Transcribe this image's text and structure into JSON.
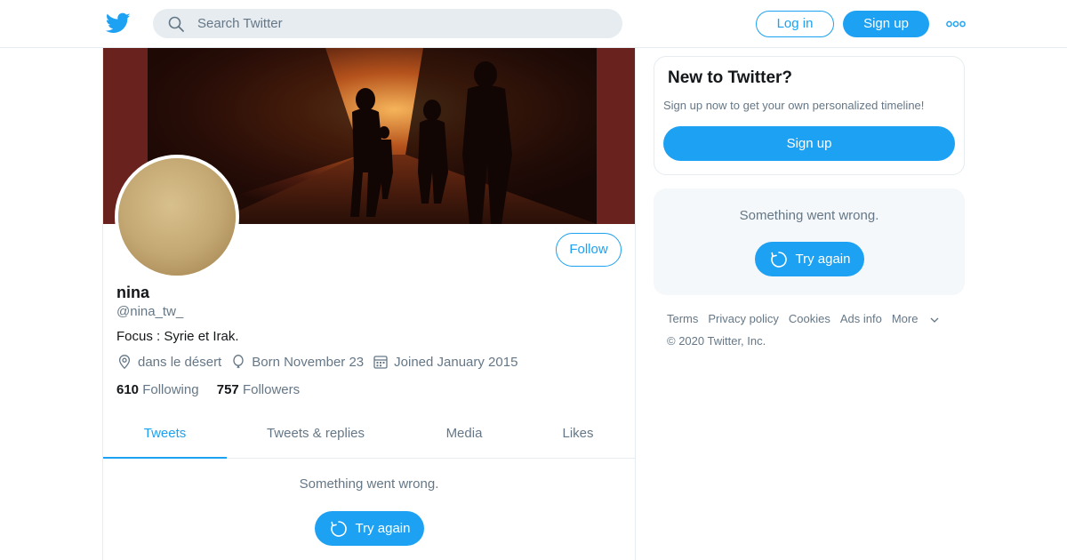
{
  "header": {
    "search_placeholder": "Search Twitter",
    "login_label": "Log in",
    "signup_label": "Sign up"
  },
  "profile": {
    "follow_label": "Follow",
    "name": "nina",
    "handle": "@nina_tw_",
    "bio": "Focus : Syrie et Irak.",
    "location": "dans le désert",
    "birthday": "Born November 23",
    "joined": "Joined January 2015",
    "following_count": "610",
    "following_label": "Following",
    "followers_count": "757",
    "followers_label": "Followers"
  },
  "tabs": [
    {
      "label": "Tweets",
      "active": true
    },
    {
      "label": "Tweets & replies",
      "active": false
    },
    {
      "label": "Media",
      "active": false
    },
    {
      "label": "Likes",
      "active": false
    }
  ],
  "timeline": {
    "error_message": "Something went wrong.",
    "retry_label": "Try again"
  },
  "sidebar": {
    "new_title": "New to Twitter?",
    "new_subtitle": "Sign up now to get your own personalized timeline!",
    "new_signup_label": "Sign up",
    "error_message": "Something went wrong.",
    "retry_label": "Try again"
  },
  "footer": {
    "links": [
      "Terms",
      "Privacy policy",
      "Cookies",
      "Ads info",
      "More"
    ],
    "copyright": "© 2020 Twitter, Inc."
  },
  "colors": {
    "accent": "#1da1f2",
    "secondary_text": "#657786",
    "border": "#e6ecf0"
  },
  "icons": [
    "twitter-bird-icon",
    "search-icon",
    "more-dots-icon",
    "location-icon",
    "balloon-icon",
    "calendar-icon",
    "refresh-icon",
    "chevron-down-icon"
  ]
}
